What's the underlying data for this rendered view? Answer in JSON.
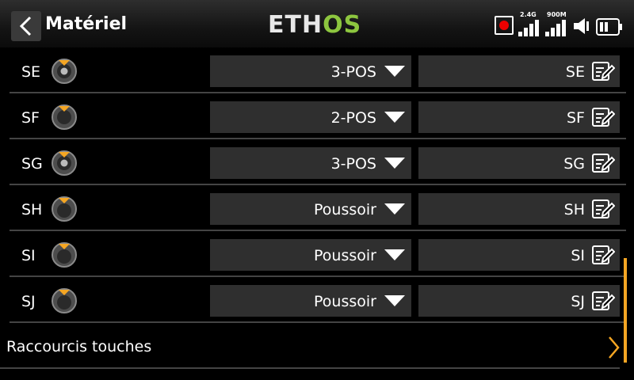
{
  "header": {
    "title": "Matériel",
    "logo_part1": "ETH",
    "logo_part2": "OS",
    "status": {
      "signal1_label": "2.4G",
      "signal2_label": "900M"
    }
  },
  "switches": [
    {
      "name": "SE",
      "type": "3-POS",
      "alias": "SE",
      "icon": "switch-3pos-icon"
    },
    {
      "name": "SF",
      "type": "2-POS",
      "alias": "SF",
      "icon": "switch-2pos-icon"
    },
    {
      "name": "SG",
      "type": "3-POS",
      "alias": "SG",
      "icon": "switch-3pos-icon"
    },
    {
      "name": "SH",
      "type": "Poussoir",
      "alias": "SH",
      "icon": "switch-push-icon"
    },
    {
      "name": "SI",
      "type": "Poussoir",
      "alias": "SI",
      "icon": "switch-push-icon"
    },
    {
      "name": "SJ",
      "type": "Poussoir",
      "alias": "SJ",
      "icon": "switch-push-icon"
    }
  ],
  "shortcut": {
    "label": "Raccourcis touches"
  },
  "colors": {
    "accent": "#f5a623",
    "logo_green": "#8dc63f",
    "field_bg": "#2f2f2f",
    "record_red": "#e00000"
  }
}
